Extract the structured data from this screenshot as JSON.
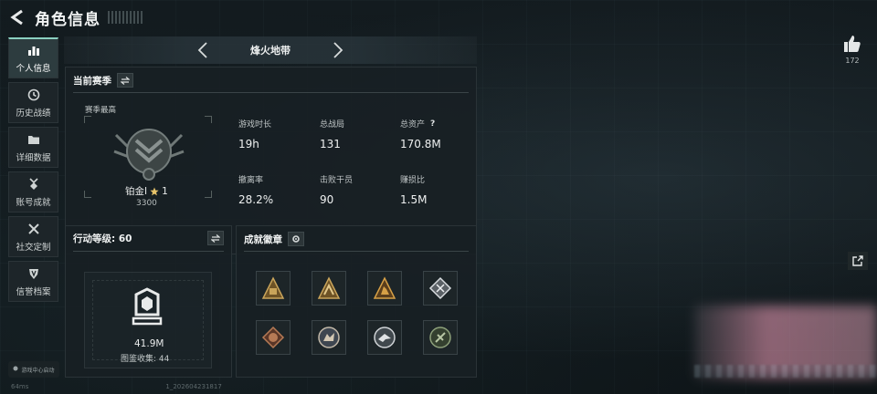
{
  "header": {
    "title": "角色信息"
  },
  "sidebar": {
    "items": [
      {
        "label": "个人信息",
        "icon": "bar-chart-icon",
        "active": true
      },
      {
        "label": "历史战绩",
        "icon": "history-icon",
        "active": false
      },
      {
        "label": "详细数据",
        "icon": "folder-icon",
        "active": false
      },
      {
        "label": "账号成就",
        "icon": "medal-icon",
        "active": false
      },
      {
        "label": "社交定制",
        "icon": "tools-icon",
        "active": false
      },
      {
        "label": "信誉档案",
        "icon": "shield-icon",
        "active": false
      }
    ],
    "footer_note": "游戏中心启动"
  },
  "season_nav": {
    "title": "烽火地带"
  },
  "season_panel": {
    "title": "当前赛季",
    "season_best_label": "赛季最高",
    "rank_name": "铂金I",
    "rank_stars": "1",
    "rank_score": "3300",
    "stats": [
      {
        "label": "游戏时长",
        "value": "19h"
      },
      {
        "label": "总战局",
        "value": "131"
      },
      {
        "label": "总资产",
        "value": "170.8M",
        "help": "?"
      },
      {
        "label": "撤离率",
        "value": "28.2%"
      },
      {
        "label": "击败干员",
        "value": "90"
      },
      {
        "label": "赚损比",
        "value": "1.5M"
      }
    ]
  },
  "action_panel": {
    "title": "行动等级: 60",
    "value": "41.9M",
    "collect_label": "图鉴收集: 44"
  },
  "badges_panel": {
    "title": "成就徽章",
    "badges": [
      {
        "icon": "camp-badge-icon",
        "color": "#c9a45a"
      },
      {
        "icon": "tent-badge-icon",
        "color": "#c9a45a"
      },
      {
        "icon": "tower-badge-icon",
        "color": "#d6a046"
      },
      {
        "icon": "shard-badge-icon",
        "color": "#d9dde0"
      },
      {
        "icon": "beast-badge-icon",
        "color": "#b67a55"
      },
      {
        "icon": "wolf-badge-icon",
        "color": "#c2b8a8"
      },
      {
        "icon": "raptor-badge-icon",
        "color": "#cfd3d6"
      },
      {
        "icon": "tech-badge-icon",
        "color": "#8da07a"
      }
    ]
  },
  "like": {
    "count": "172"
  },
  "status_bar": {
    "ping": "64ms",
    "build": "1_202604231817"
  }
}
